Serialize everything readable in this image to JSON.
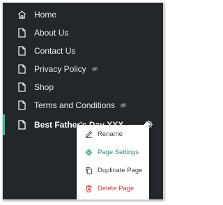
{
  "nav": {
    "items": [
      {
        "label": "Home",
        "icon": "home-icon"
      },
      {
        "label": "About Us",
        "icon": "page-icon"
      },
      {
        "label": "Contact Us",
        "icon": "page-icon"
      },
      {
        "label": "Privacy Policy",
        "icon": "page-icon",
        "hidden_icon": "eye-slash-icon"
      },
      {
        "label": "Shop",
        "icon": "page-icon"
      },
      {
        "label": "Terms and Conditions",
        "icon": "page-icon",
        "hidden_icon": "eye-slash-icon"
      }
    ],
    "active_item": {
      "label": "Best Father's Day XXX",
      "icon": "page-icon",
      "action_icon": "gear-icon"
    }
  },
  "context_menu": {
    "items": [
      {
        "label": "Rename",
        "icon": "pencil-icon"
      },
      {
        "label": "Page Settings",
        "icon": "gear-icon"
      },
      {
        "label": "Duplicate Page",
        "icon": "copy-icon"
      },
      {
        "label": "Delete Page",
        "icon": "trash-icon"
      }
    ]
  },
  "colors": {
    "panel_bg": "#23272a",
    "accent": "#2fb9a6",
    "danger": "#d9372f",
    "text_light": "#e9eaeb"
  }
}
